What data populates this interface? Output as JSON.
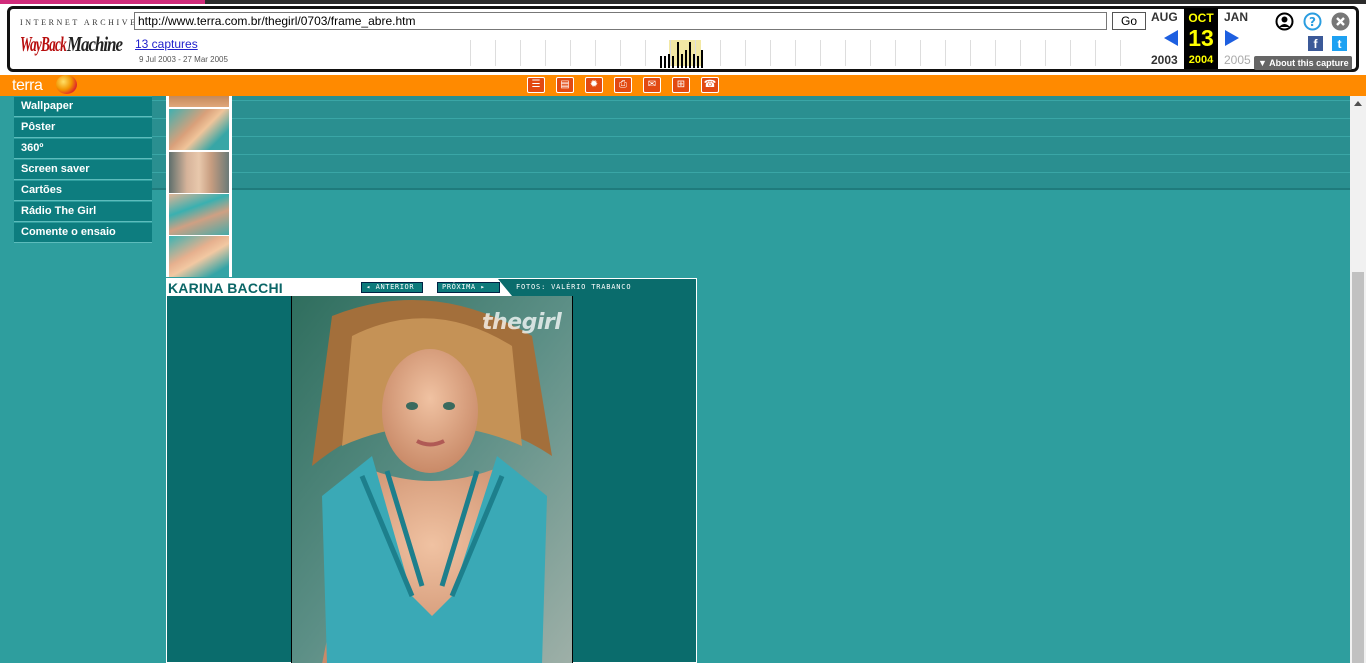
{
  "wayback": {
    "logo_top": "INTERNET ARCHIVE",
    "logo_text": "WayBackMachine",
    "url": "http://www.terra.com.br/thegirl/0703/frame_abre.htm",
    "go_label": "Go",
    "captures_link": "13 captures",
    "date_range": "9 Jul 2003 - 27 Mar 2005",
    "prev_month": "AUG",
    "prev_year": "2003",
    "cur_month": "OCT",
    "cur_day": "13",
    "cur_year": "2004",
    "next_month": "JAN",
    "next_year": "2005",
    "about_label": "About this capture",
    "colors": {
      "accent": "#1d5fe0",
      "current_bg": "#000000",
      "current_fg": "#ffff00"
    }
  },
  "terra": {
    "brand": "terra",
    "tools": [
      "chat-icon",
      "document-icon",
      "star-icon",
      "print-icon",
      "mail-icon",
      "cart-icon",
      "contact-icon"
    ],
    "bar_color": "#ff8a00"
  },
  "menu": {
    "items": [
      {
        "label": "Wallpaper"
      },
      {
        "label": "Pôster"
      },
      {
        "label": "360º"
      },
      {
        "label": "Screen saver"
      },
      {
        "label": "Cartões"
      },
      {
        "label": "Rádio The Girl"
      },
      {
        "label": "Comente o ensaio"
      }
    ]
  },
  "viewer": {
    "title": "KARINA BACCHI",
    "prev_label": "ANTERIOR",
    "next_label": "PRÓXIMA",
    "credit": "FOTOS: VALÉRIO TRABANCO",
    "watermark": "thegirl"
  },
  "theme": {
    "page_bg": "#2e9e9e",
    "menu_bg": "#0d7d7f",
    "viewer_bg": "#0a6c6c"
  }
}
